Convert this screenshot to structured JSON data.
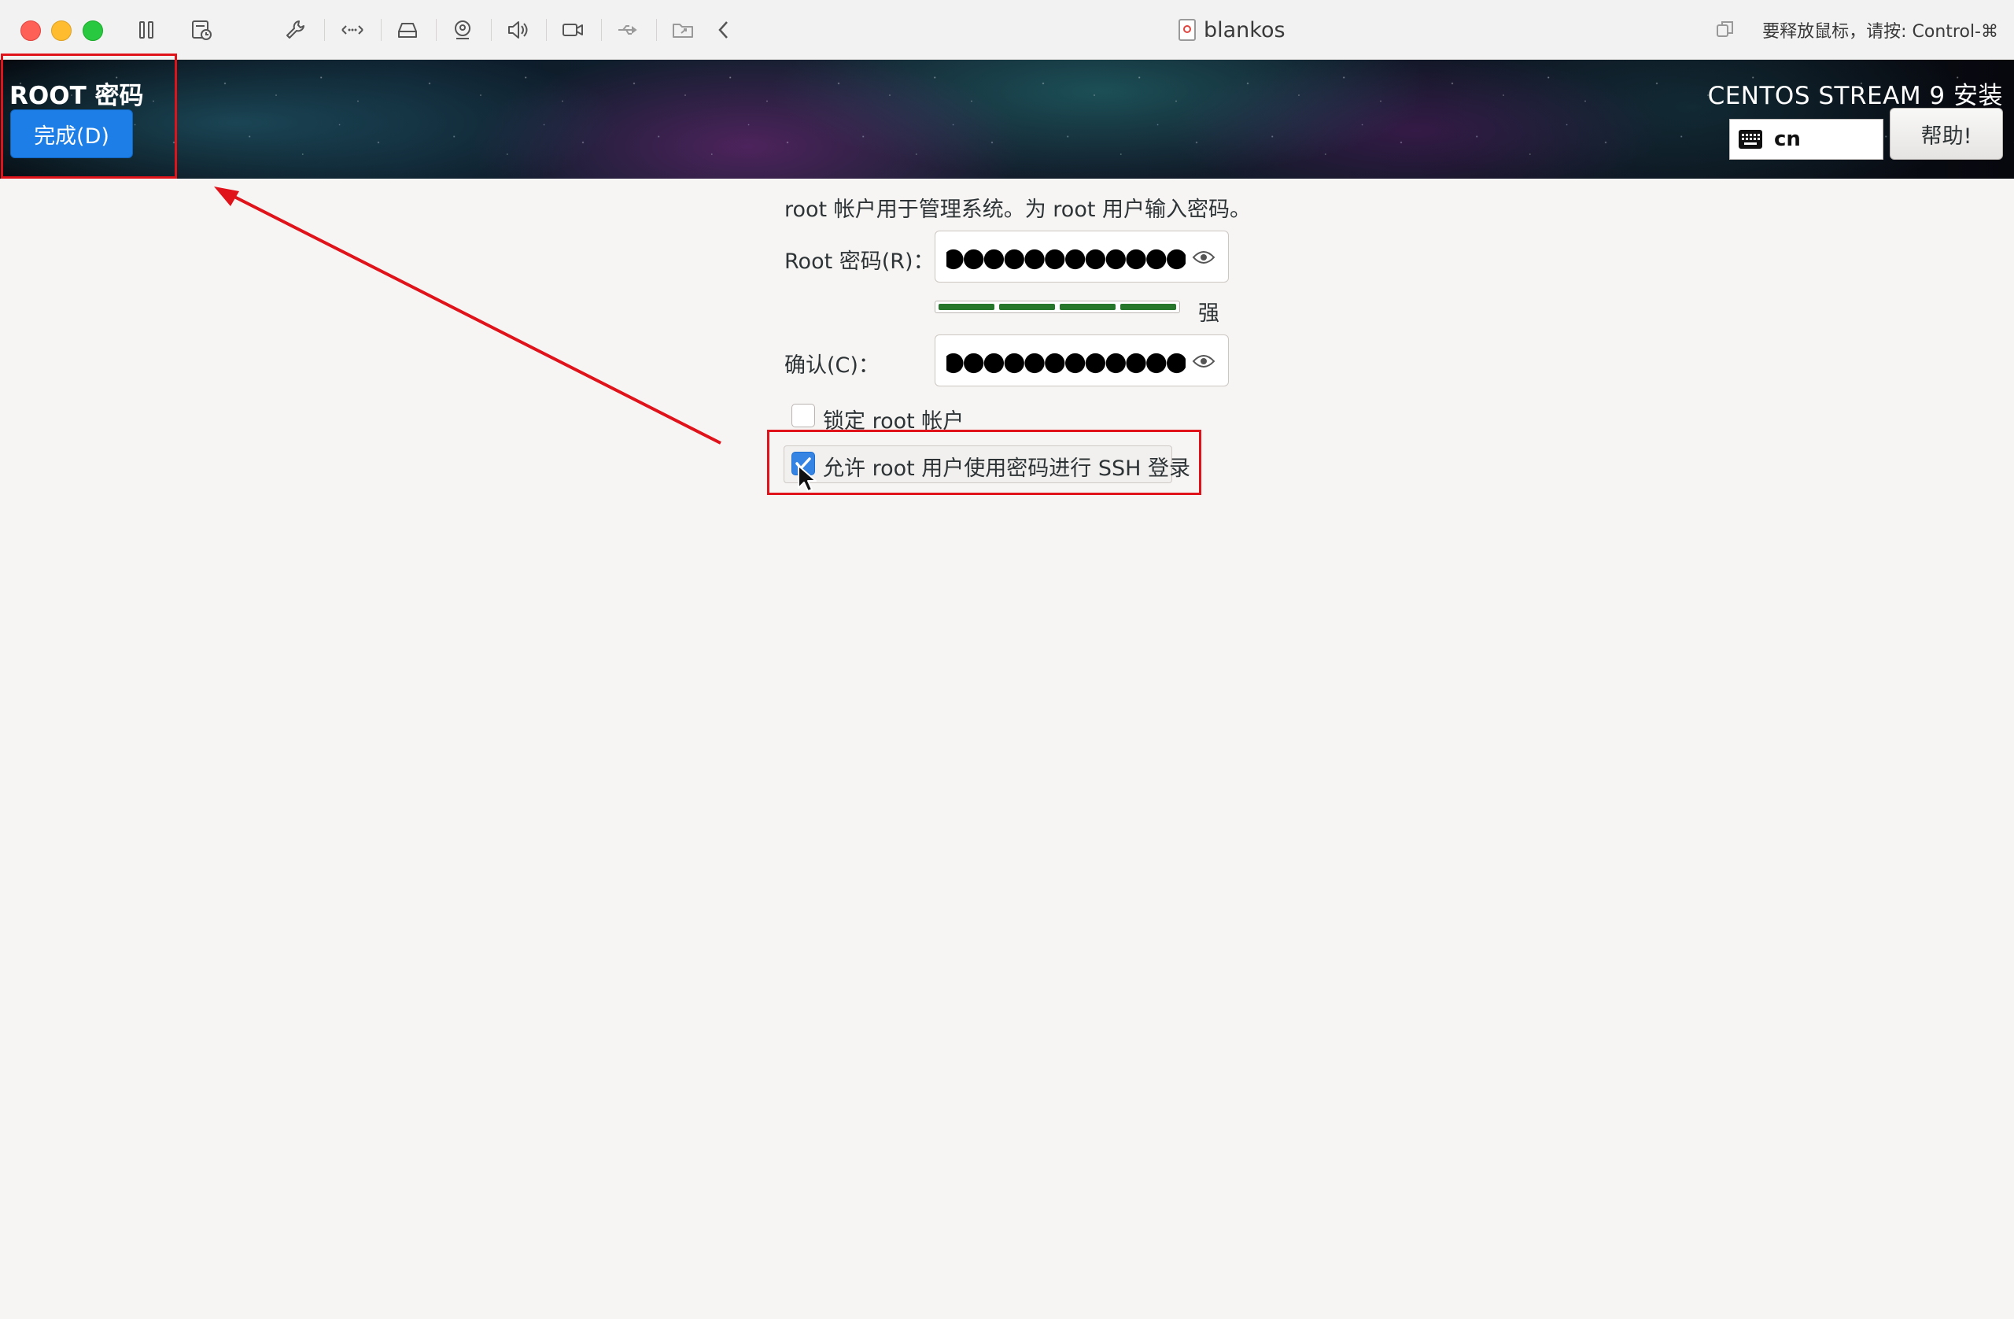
{
  "window": {
    "title": "blankos",
    "release_hint": "要释放鼠标，请按: Control-⌘",
    "toolbar_icons": [
      "pause-icon",
      "snapshot-icon",
      "wrench-icon",
      "network-arrows-icon",
      "disk-icon",
      "camera-icon",
      "sound-icon",
      "video-icon",
      "usb-icon",
      "shared-folder-icon",
      "chevron-left-icon"
    ]
  },
  "header": {
    "spoke_title": "ROOT 密码",
    "done_label": "完成(D)",
    "product_title": "CENTOS STREAM 9 安装",
    "keyboard_layout": "cn",
    "help_label": "帮助!"
  },
  "form": {
    "intro": "root 帐户用于管理系统。为 root 用户输入密码。",
    "password_label": "Root 密码(R)：",
    "password_masked": "●●●●●●●●●●●●●●●",
    "strength_label": "强",
    "strength_fraction": 1.0,
    "confirm_label": "确认(C)：",
    "confirm_masked": "●●●●●●●●●●●●●●●",
    "lock_root_label": "锁定 root 帐户",
    "lock_root_checked": false,
    "allow_ssh_label": "允许 root 用户使用密码进行 SSH 登录",
    "allow_ssh_checked": true
  },
  "colors": {
    "annotation": "#e0121a",
    "done_button": "#1c7ee6",
    "checkbox_checked": "#3584e4",
    "strength_fill": "#26772c"
  }
}
